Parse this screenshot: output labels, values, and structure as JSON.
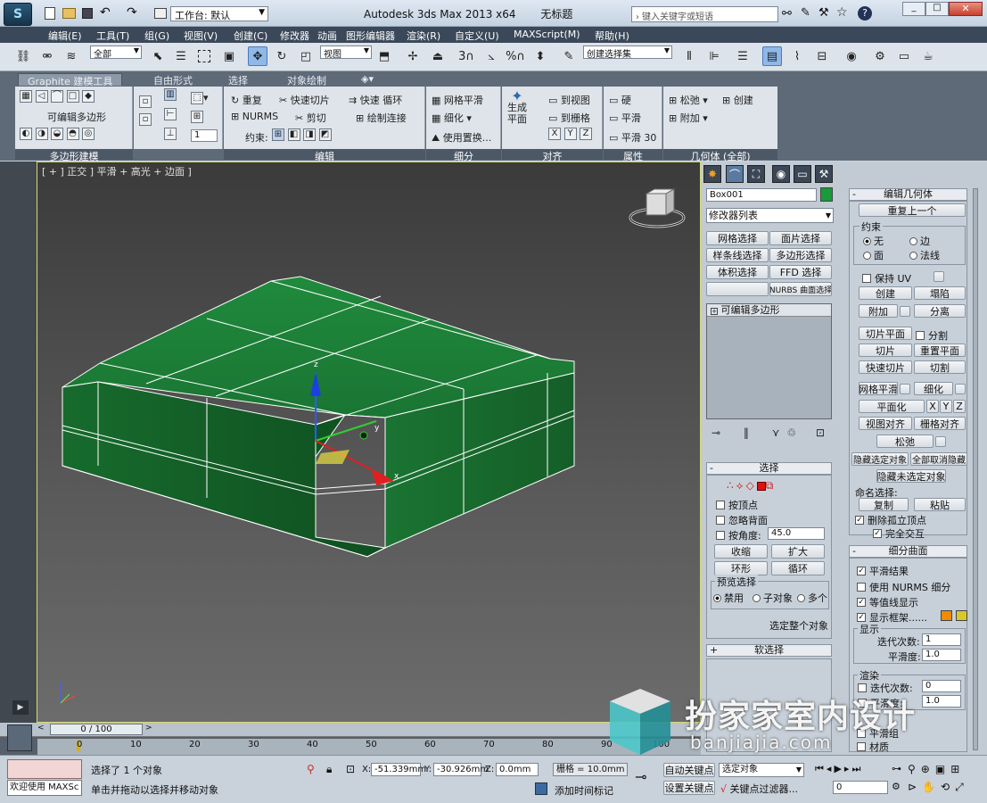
{
  "titlebar": {
    "workspace_label": "工作台: 默认",
    "app_title": "Autodesk 3ds Max  2013 x64",
    "doc_title": "无标题",
    "search_placeholder": "键入关键字或短语"
  },
  "menu": [
    "编辑(E)",
    "工具(T)",
    "组(G)",
    "视图(V)",
    "创建(C)",
    "修改器",
    "动画",
    "图形编辑器",
    "渲染(R)",
    "自定义(U)",
    "MAXScript(M)",
    "帮助(H)"
  ],
  "main_toolbar": {
    "filter_select": "全部",
    "ref_coord_select": "视图",
    "snap_3": "3",
    "snap_percent": "%",
    "named_selection": "创建选择集"
  },
  "ribbon": {
    "tabs": [
      "Graphite 建模工具",
      "自由形式",
      "选择",
      "对象绘制"
    ],
    "panel_polymodel": {
      "mode": "可编辑多边形",
      "label": "多边形建模"
    },
    "panel_edit": {
      "repeat": "重复",
      "quickslice": "快速切片",
      "quickloop": "快速 循环",
      "nurms": "NURMS",
      "cut": "剪切",
      "paintconnect": "绘制连接",
      "constraint": "约束:",
      "label": "编辑"
    },
    "panel_subdiv": {
      "meshsmooth": "网格平滑",
      "tessellate": "细化",
      "usedisplace": "使用置换...",
      "label": "细分"
    },
    "panel_align": {
      "makeplanar_1": "生成",
      "makeplanar_2": "平面",
      "toview": "到视图",
      "togrid": "到栅格",
      "x": "X",
      "y": "Y",
      "z": "Z",
      "label": "对齐"
    },
    "panel_props": {
      "hard": "硬",
      "smooth": "平滑",
      "smooth30": "平滑 30",
      "label": "属性"
    },
    "panel_geom": {
      "relax": "松弛",
      "create": "创建",
      "attach": "附加",
      "label": "几何体 (全部)"
    },
    "spinner_value": "1"
  },
  "viewport": {
    "label": "[ + ] 正交 ] 平滑 + 高光 + 边面 ]",
    "gizmo_x": "x",
    "gizmo_y": "y",
    "gizmo_z": "z"
  },
  "cmd": {
    "object_name": "Box001",
    "object_color": "#1a9a3a",
    "modifier_list": "修改器列表",
    "mod_buttons": [
      "网格选择",
      "面片选择",
      "样条线选择",
      "多边形选择",
      "体积选择",
      "FFD 选择",
      "NURBS 曲面选择"
    ],
    "stack_item": "可编辑多边形",
    "selection": {
      "title": "选择",
      "by_vertex": "按顶点",
      "ignore_backface": "忽略背面",
      "by_angle": "按角度:",
      "angle_value": "45.0",
      "shrink": "收缩",
      "grow": "扩大",
      "ring": "环形",
      "loop": "循环",
      "preview_title": "预览选择",
      "preview_off": "禁用",
      "preview_sub": "子对象",
      "preview_multi": "多个",
      "whole_object": "选定整个对象"
    },
    "soft_selection": "软选择",
    "edit_geometry": {
      "title": "编辑几何体",
      "repeat_last": "重复上一个",
      "constraints": "约束",
      "c_none": "无",
      "c_edge": "边",
      "c_face": "面",
      "c_normal": "法线",
      "preserve_uv": "保持 UV",
      "create": "创建",
      "collapse": "塌陷",
      "attach": "附加",
      "detach": "分离",
      "slice_plane": "切片平面",
      "split": "分割",
      "slice": "切片",
      "reset_plane": "重置平面",
      "quickslice": "快速切片",
      "cut": "切割",
      "meshsmooth": "网格平滑",
      "tessellate": "细化",
      "planarize": "平面化",
      "x": "X",
      "y": "Y",
      "z": "Z",
      "view_align": "视图对齐",
      "grid_align": "栅格对齐",
      "relax": "松弛",
      "hide_sel": "隐藏选定对象",
      "unhide_all": "全部取消隐藏",
      "hide_unsel": "隐藏未选定对象",
      "named_sel": "命名选择:",
      "copy": "复制",
      "paste": "粘贴",
      "delete_isolated": "删除孤立顶点",
      "full_interact": "完全交互"
    },
    "subdiv_surface": {
      "title": "细分曲面",
      "smooth_result": "平滑结果",
      "use_nurms": "使用 NURMS 细分",
      "isoline": "等值线显示",
      "show_cage": "显示框架......",
      "cage_color1": "#f08c00",
      "cage_color2": "#d8c828",
      "display": "显示",
      "iterations": "迭代次数:",
      "iter_val": "1",
      "smoothness": "平滑度:",
      "smooth_val": "1.0",
      "render": "渲染",
      "r_iterations": "迭代次数:",
      "r_iter_val": "0",
      "r_smoothness": "平滑度:",
      "r_smooth_val": "1.0",
      "smooth_group": "平滑组",
      "material": "材质"
    }
  },
  "timeline": {
    "frame_display": "0 / 100",
    "ticks": [
      "0",
      "10",
      "20",
      "30",
      "40",
      "50",
      "60",
      "70",
      "80",
      "90",
      "100"
    ]
  },
  "status": {
    "maxscript": "欢迎使用 MAXSc",
    "selected": "选择了 1 个对象",
    "prompt": "单击并拖动以选择并移动对象",
    "x_label": "X:",
    "x_value": "-51.339mm",
    "y_label": "Y:",
    "y_value": "-30.926mm",
    "z_label": "Z:",
    "z_value": "0.0mm",
    "grid": "栅格 = 10.0mm",
    "add_time_tag": "添加时间标记",
    "auto_key": "自动关键点",
    "set_key": "设置关键点",
    "key_mode": "选定对象",
    "key_filters": "关键点过滤器...",
    "frame": "0"
  },
  "watermark": {
    "cn": "扮家家室内设计",
    "url": "banjiajia.com"
  }
}
